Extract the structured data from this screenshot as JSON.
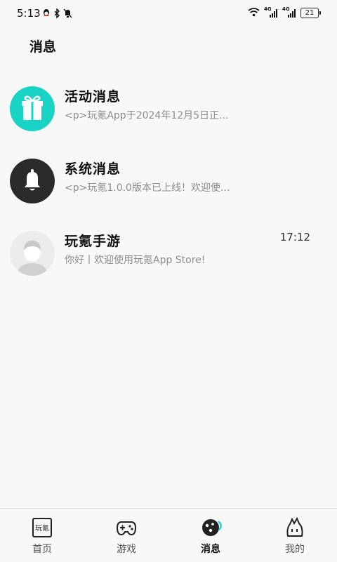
{
  "status_bar": {
    "time": "5:13",
    "network_left": "4G",
    "network_right": "4G",
    "battery": "21",
    "icons": [
      "qq-icon",
      "bluetooth-icon",
      "mute-bell-icon",
      "wifi-icon",
      "signal-icon",
      "signal-icon",
      "battery-icon"
    ]
  },
  "header": {
    "title": "消息"
  },
  "messages": [
    {
      "title": "活动消息",
      "preview": "<p>玩氪App于2024年12月5日正...",
      "time": "",
      "avatar": "gift-icon",
      "avatar_color": "#19d3c5"
    },
    {
      "title": "系统消息",
      "preview": "<p>玩氪1.0.0版本已上线！欢迎使...",
      "time": "",
      "avatar": "bell-icon",
      "avatar_color": "#2b2b2b"
    },
    {
      "title": "玩氪手游",
      "preview": "你好丨欢迎使用玩氪App Store!",
      "time": "17:12",
      "avatar": "default-user-avatar",
      "avatar_color": "#e8e8e8"
    }
  ],
  "tab_bar": {
    "tabs": [
      {
        "label": "首页",
        "icon": "home-logo-icon",
        "icon_text": "玩氪",
        "active": false
      },
      {
        "label": "游戏",
        "icon": "gamepad-icon",
        "active": false
      },
      {
        "label": "消息",
        "icon": "planet-message-icon",
        "active": true
      },
      {
        "label": "我的",
        "icon": "profile-face-icon",
        "active": false
      }
    ]
  }
}
